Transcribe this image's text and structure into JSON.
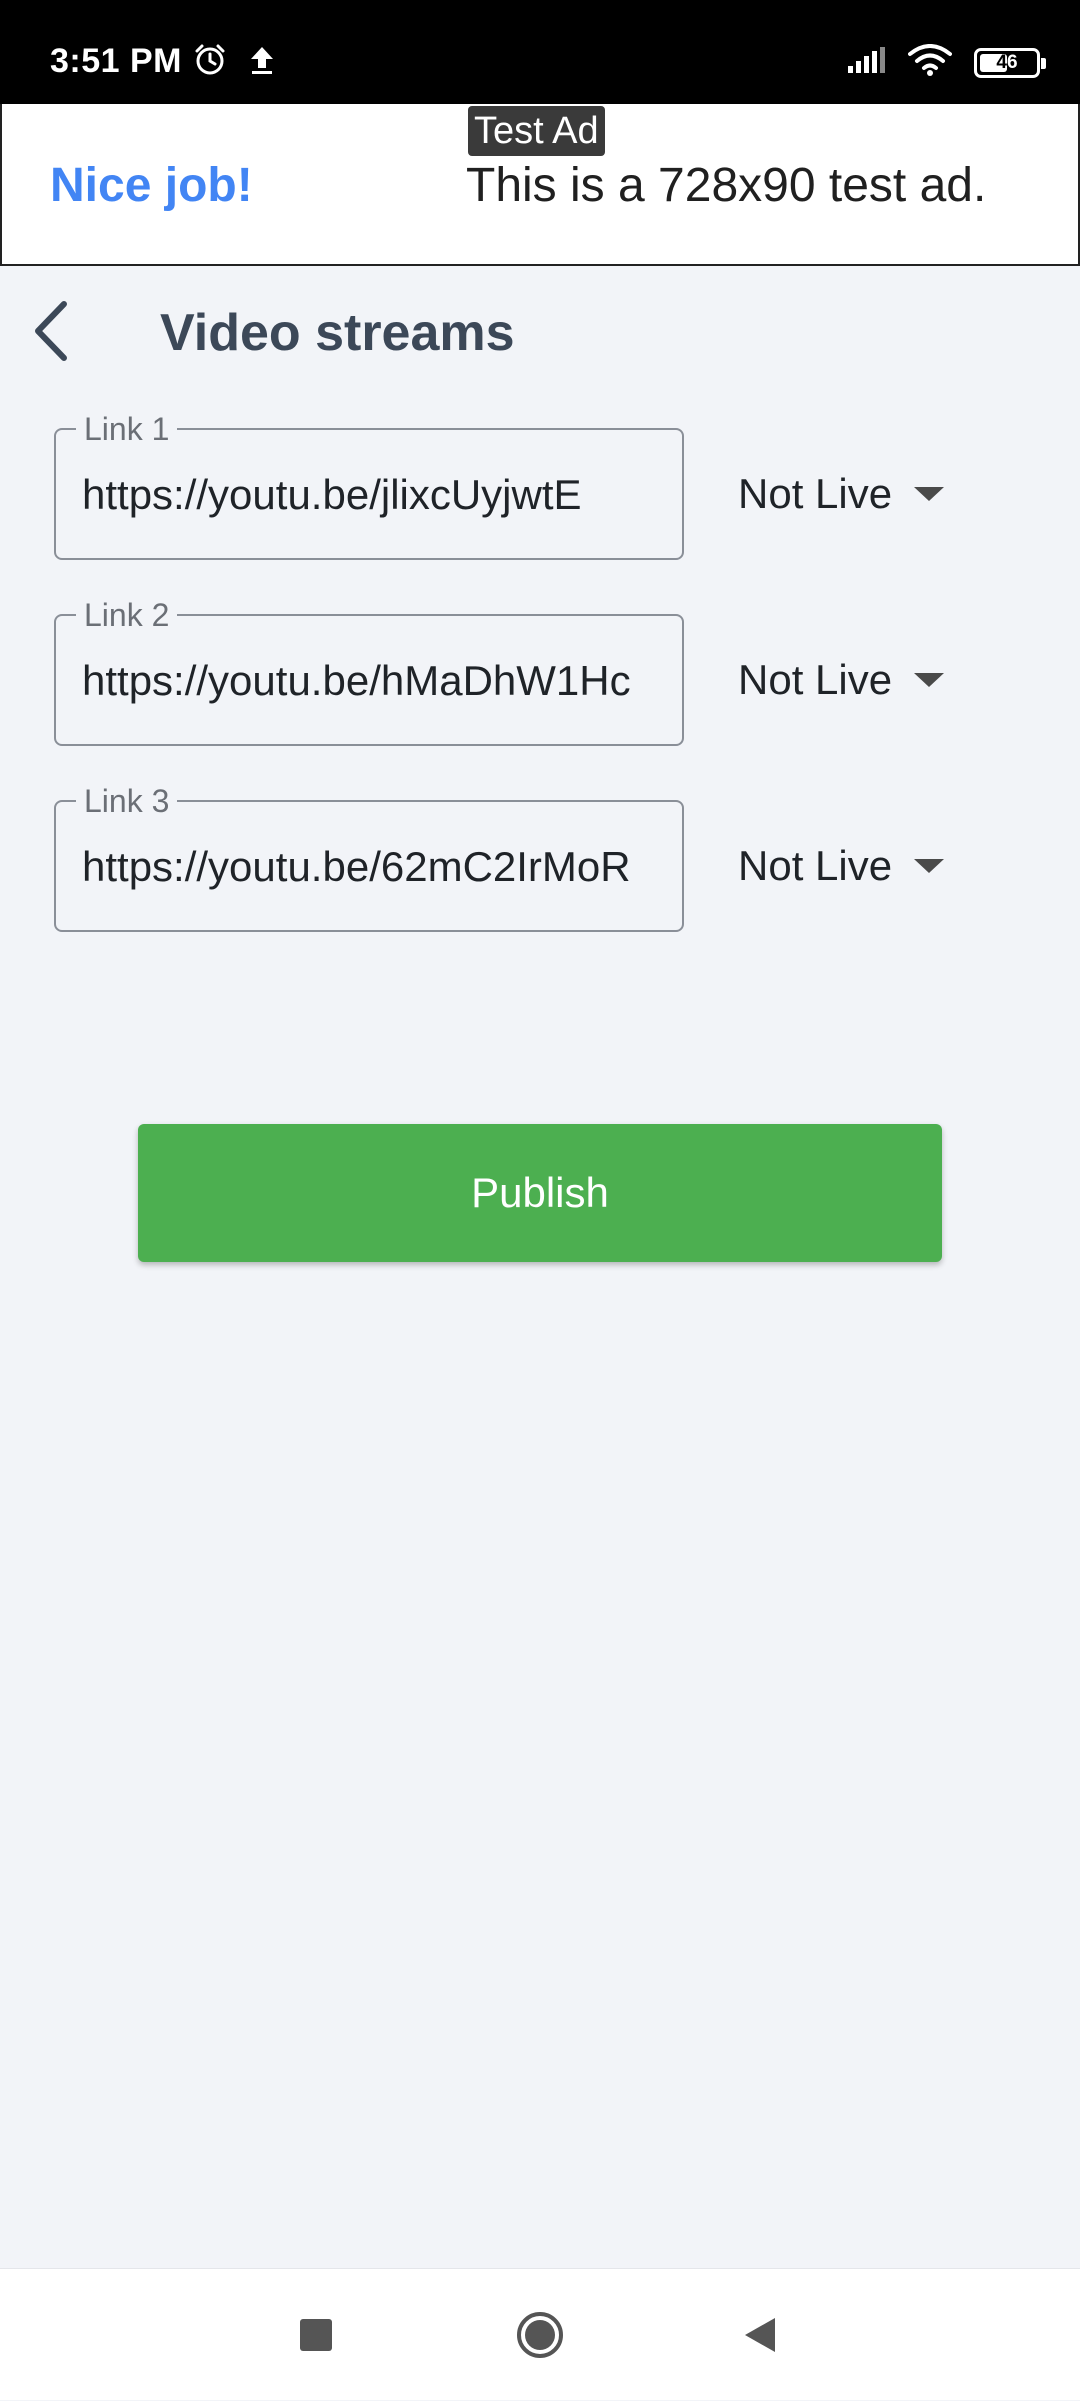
{
  "status_bar": {
    "time": "3:51 PM",
    "left_icons": [
      "alarm-icon",
      "upload-icon"
    ],
    "right_icons": [
      "signal-icon",
      "wifi-icon",
      "battery-icon"
    ],
    "battery_level": "46"
  },
  "ad": {
    "badge": "Test Ad",
    "headline": "Nice job!",
    "text": "This is a 728x90 test ad.",
    "headline_color": "#4285f4"
  },
  "header": {
    "title": "Video streams",
    "back_icon": "chevron-left-icon"
  },
  "links": [
    {
      "label": "Link 1",
      "value": "https://youtu.be/jlixcUyjwtE",
      "status": "Not Live"
    },
    {
      "label": "Link 2",
      "value": "https://youtu.be/hMaDhW1Hc",
      "status": "Not Live"
    },
    {
      "label": "Link 3",
      "value": "https://youtu.be/62mC2IrMoR",
      "status": "Not Live"
    }
  ],
  "publish": {
    "label": "Publish",
    "color": "#4caf50"
  },
  "nav_bar": {
    "icons": [
      "recents-square-icon",
      "home-circle-icon",
      "back-triangle-icon"
    ]
  }
}
